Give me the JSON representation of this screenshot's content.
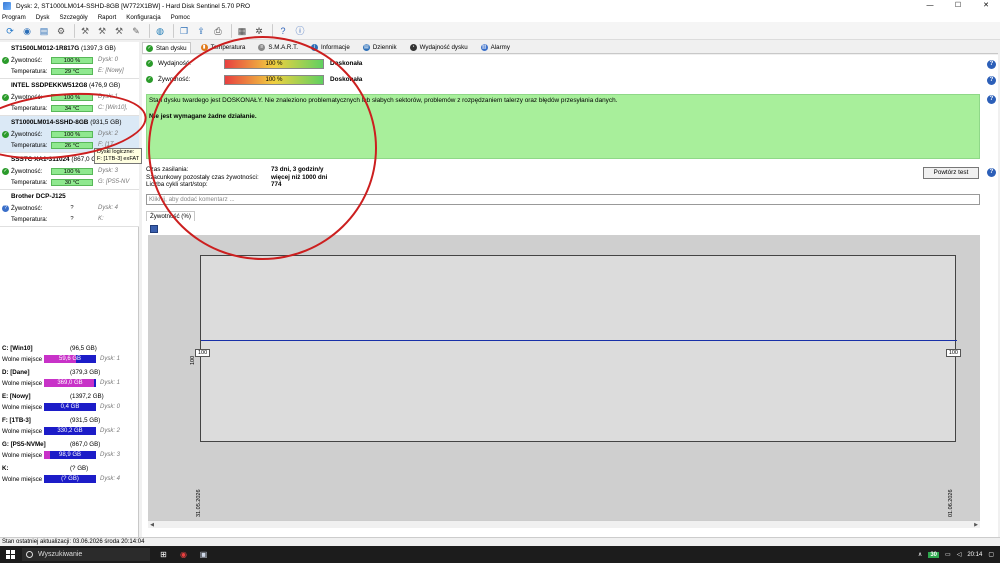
{
  "window": {
    "title": "Dysk: 2, ST1000LM014-SSHD-8GB [W772X1BW]  -  Hard Disk Sentinel 5.70 PRO",
    "min": "—",
    "max": "☐",
    "close": "✕"
  },
  "menu": [
    "Program",
    "Dysk",
    "Szczegóły",
    "Raport",
    "Konfiguracja",
    "Pomoc"
  ],
  "disks": [
    {
      "name": "ST1500LM012-1R817G",
      "size": "(1397,3 GB)",
      "health_label": "Żywotność:",
      "health": "100 %",
      "health_pct": 100,
      "disk_label": "Dysk: 0",
      "temp_label": "Temperatura:",
      "temp": "29 °C",
      "vol_label": "E: [Nowy]",
      "status": "ok"
    },
    {
      "name": "INTEL SSDPEKKW512G8",
      "size": "(476,9 GB)",
      "health_label": "Żywotność:",
      "health": "100 %",
      "health_pct": 100,
      "disk_label": "Dysk: 1",
      "temp_label": "Temperatura:",
      "temp": "34 °C",
      "vol_label": "C: [Win10],",
      "status": "ok"
    },
    {
      "name": "ST1000LM014-SSHD-8GB",
      "size": "(931,5 GB)",
      "health_label": "Żywotność:",
      "health": "100 %",
      "health_pct": 100,
      "disk_label": "Dysk: 2",
      "temp_label": "Temperatura:",
      "temp": "26 °C",
      "vol_label": "F: [1T",
      "status": "ok",
      "selected": true
    },
    {
      "name": "SSSTC XA1-311024",
      "size": "(867,0 GB)",
      "health_label": "Żywotność:",
      "health": "100 %",
      "health_pct": 100,
      "disk_label": "Dysk: 3",
      "temp_label": "Temperatura:",
      "temp": "30 °C",
      "vol_label": "G: [PS5-NV",
      "status": "ok"
    },
    {
      "name": "Brother DCP-J125",
      "size": "",
      "health_label": "Żywotność:",
      "health": "?",
      "health_pct": 0,
      "disk_label": "Dysk: 4",
      "temp_label": "Temperatura:",
      "temp": "?",
      "vol_label": "K:",
      "status": "unknown"
    }
  ],
  "tooltip": {
    "line1": "Dyski logiczne:",
    "line2": "F: [1TB-3] exFAT"
  },
  "volumes": [
    {
      "name": "C: [Win10]",
      "size": "(96,5 GB)",
      "free_label": "Wolne miejsce",
      "free": "59,6 GB",
      "fill_pct": 62,
      "color": "#c832c8",
      "disk": "Dysk: 1"
    },
    {
      "name": "D: [Dane]",
      "size": "(379,3 GB)",
      "free_label": "Wolne miejsce",
      "free": "369,0 GB",
      "fill_pct": 97,
      "color": "#c832c8",
      "disk": "Dysk: 1"
    },
    {
      "name": "E: [Nowy]",
      "size": "(1397,2 GB)",
      "free_label": "Wolne miejsce",
      "free": "0,4 GB",
      "fill_pct": 0,
      "color": "#1c1cc8",
      "disk": "Dysk: 0"
    },
    {
      "name": "F: [1TB-3]",
      "size": "(931,5 GB)",
      "free_label": "Wolne miejsce",
      "free": "330,2 GB",
      "fill_pct": 35,
      "color": "#1c1cc8",
      "disk": "Dysk: 2"
    },
    {
      "name": "G: [PS5-NVMe]",
      "size": "(867,0 GB)",
      "free_label": "Wolne miejsce",
      "free": "98,9 GB",
      "fill_pct": 11,
      "color": "#c832c8",
      "disk": "Dysk: 3"
    },
    {
      "name": "K:",
      "size": "(? GB)",
      "free_label": "Wolne miejsce",
      "free": "(? GB)",
      "fill_pct": 0,
      "color": "#1c1cc8",
      "disk": "Dysk: 4"
    }
  ],
  "tabs": [
    "Stan dysku",
    "Temperatura",
    "S.M.A.R.T.",
    "Informacje",
    "Dziennik",
    "Wydajność dysku",
    "Alarmy"
  ],
  "perf": {
    "label": "Wydajność:",
    "value": "100 %",
    "pct": 100,
    "rating": "Doskonała"
  },
  "health": {
    "label": "Żywotność:",
    "value": "100 %",
    "pct": 100,
    "rating": "Doskonała"
  },
  "status_text": "Stan dysku twardego jest DOSKONAŁY. Nie znaleziono problematycznych lub słabych sektorów, problemów z rozpędzaniem talerzy oraz błędów przesyłania danych.",
  "action_text": "Nie jest wymagane żadne działanie.",
  "info": [
    {
      "label": "Czas zasilania:",
      "value": "73 dni, 3 godzin/y"
    },
    {
      "label": "Szacunkowy pozostały czas żywotności:",
      "value": "więcej niż 1000 dni"
    },
    {
      "label": "Liczba cykli start/stop:",
      "value": "774"
    }
  ],
  "retest_label": "Powtórz test",
  "comment_placeholder": "Kliknij, aby dodać komentarz ...",
  "chart_subtab": "Żywotność (%)",
  "chart_data": {
    "type": "line",
    "x": [
      "31.05.2026",
      "01.06.2026"
    ],
    "series": [
      {
        "values": [
          100,
          100
        ]
      }
    ],
    "point_labels": [
      "100",
      "100"
    ],
    "y_tick": "100",
    "color": "#1830a8"
  },
  "statusbar": "Stan ostatniej aktualizacji: 03.06.2026 środa 20:14:04",
  "taskbar": {
    "search": "Wyszukiwanie",
    "tray_temp": "30",
    "time": "20:14"
  }
}
